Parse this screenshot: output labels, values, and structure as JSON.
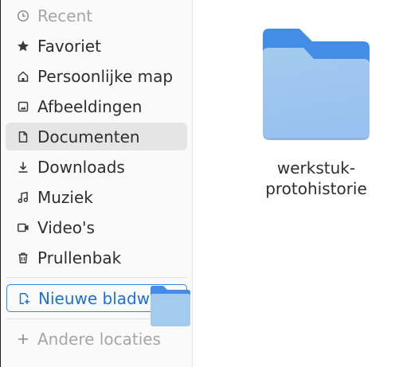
{
  "sidebar": {
    "items": [
      {
        "label": "Recent",
        "icon": "clock-icon"
      },
      {
        "label": "Favoriet",
        "icon": "star-icon"
      },
      {
        "label": "Persoonlijke map",
        "icon": "home-icon"
      },
      {
        "label": "Afbeeldingen",
        "icon": "image-icon"
      },
      {
        "label": "Documenten",
        "icon": "document-icon",
        "selected": true
      },
      {
        "label": "Downloads",
        "icon": "download-icon"
      },
      {
        "label": "Muziek",
        "icon": "music-icon"
      },
      {
        "label": "Video's",
        "icon": "video-icon"
      },
      {
        "label": "Prullenbak",
        "icon": "trash-icon"
      }
    ],
    "new_bookmark_label": "Nieuwe bladwijzer",
    "other_locations_label": "Andere locaties"
  },
  "main": {
    "files": [
      {
        "name": "werkstuk-\nprotohistorie",
        "name_line1": "werkstuk-",
        "name_line2": "protohistorie",
        "type": "folder"
      }
    ]
  },
  "colors": {
    "accent": "#3584e4",
    "folder_back": "#438de6",
    "folder_front_top": "#a4caee",
    "folder_front_bottom": "#99c1f1",
    "selected_bg": "#e5e5e5",
    "sidebar_bg": "#fafafa"
  }
}
